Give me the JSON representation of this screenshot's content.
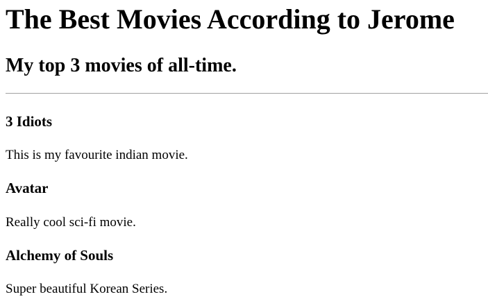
{
  "page": {
    "title": "The Best Movies According to Jerome",
    "subtitle": "My top 3 movies of all-time."
  },
  "movies": [
    {
      "title": "3 Idiots",
      "description": "This is my favourite indian movie."
    },
    {
      "title": "Avatar",
      "description": "Really cool sci-fi movie."
    },
    {
      "title": "Alchemy of Souls",
      "description": "Super beautiful Korean Series."
    }
  ]
}
